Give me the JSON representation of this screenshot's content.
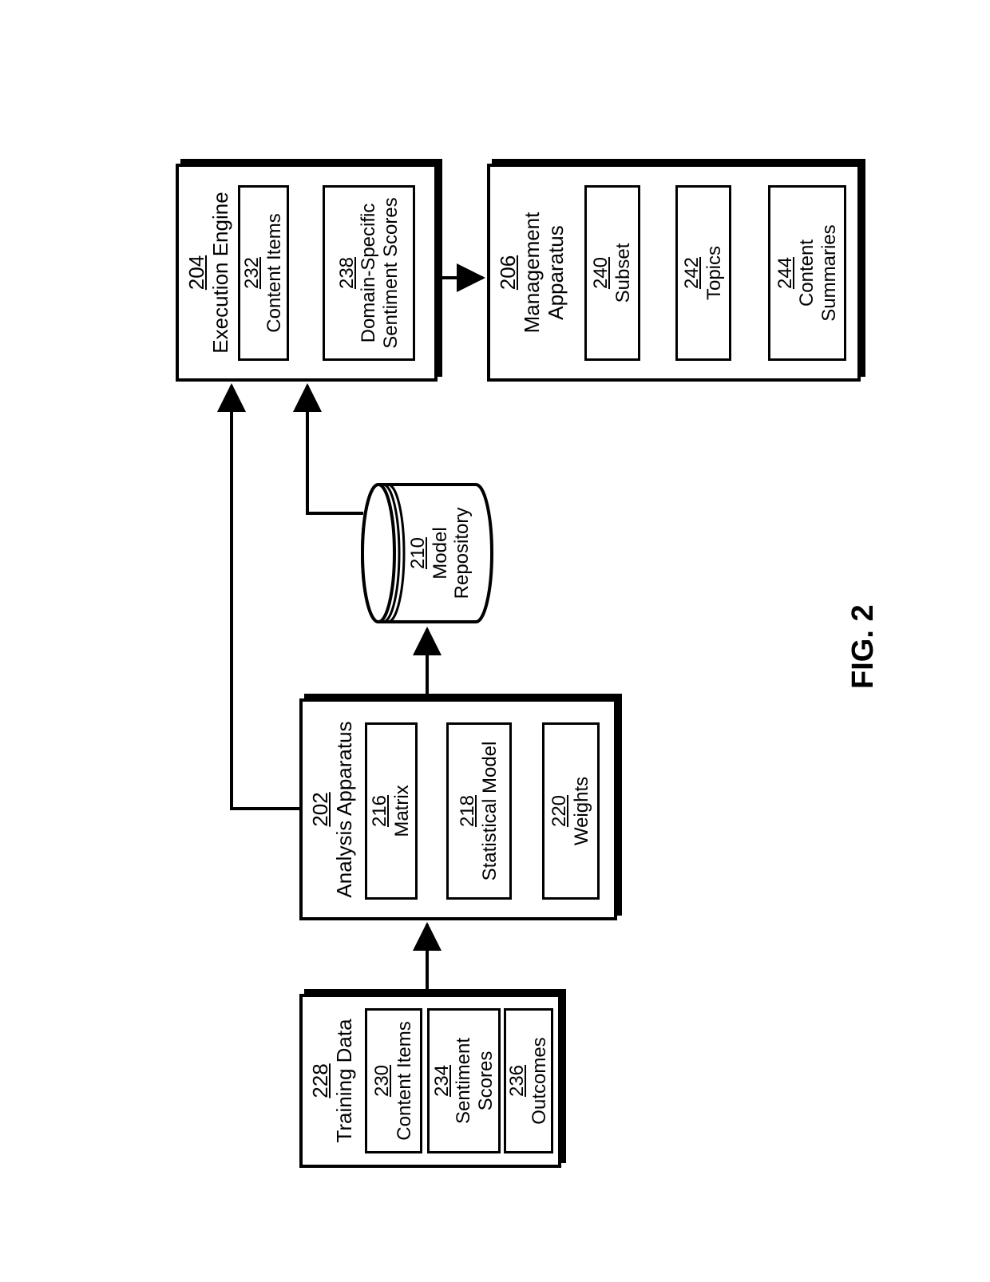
{
  "figure": {
    "label": "FIG. 2"
  },
  "training": {
    "ref": "228",
    "label": "Training Data",
    "content_items": {
      "ref": "230",
      "label": "Content Items"
    },
    "sentiment": {
      "ref": "234",
      "label": "Sentiment",
      "label2": "Scores"
    },
    "outcomes": {
      "ref": "236",
      "label": "Outcomes"
    }
  },
  "analysis": {
    "ref": "202",
    "label": "Analysis Apparatus",
    "matrix": {
      "ref": "216",
      "label": "Matrix"
    },
    "model": {
      "ref": "218",
      "label": "Statistical Model"
    },
    "weights": {
      "ref": "220",
      "label": "Weights"
    }
  },
  "repo": {
    "ref": "210",
    "label": "Model",
    "label2": "Repository"
  },
  "exec": {
    "ref": "204",
    "label": "Execution Engine",
    "content_items": {
      "ref": "232",
      "label": "Content Items"
    },
    "scores": {
      "ref": "238",
      "label": "Domain-Specific",
      "label2": "Sentiment Scores"
    }
  },
  "mgmt": {
    "ref": "206",
    "label": "Management",
    "label2": "Apparatus",
    "subset": {
      "ref": "240",
      "label": "Subset"
    },
    "topics": {
      "ref": "242",
      "label": "Topics"
    },
    "summaries": {
      "ref": "244",
      "label": "Content",
      "label2": "Summaries"
    }
  }
}
